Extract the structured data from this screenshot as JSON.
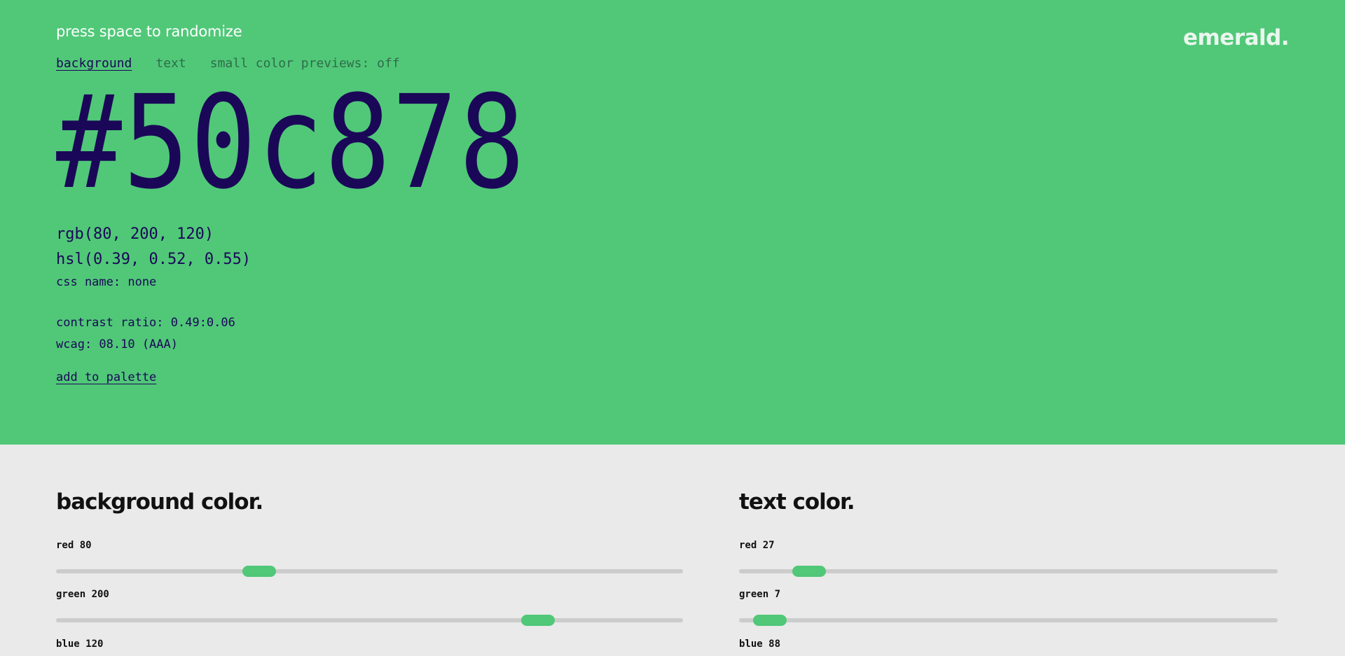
{
  "header": {
    "hint": "press space to randomize",
    "brand": "emerald."
  },
  "tabs": [
    {
      "label": "background",
      "active": true
    },
    {
      "label": "text",
      "active": false
    },
    {
      "label": "small color previews: off",
      "active": false
    }
  ],
  "color": {
    "hex": "#50c878",
    "rgb": "rgb(80, 200, 120)",
    "hsl": "hsl(0.39, 0.52, 0.55)",
    "css_name": "css name: none",
    "contrast": "contrast ratio: 0.49:0.06",
    "wcag": "wcag: 08.10 (AAA)",
    "add_label": "add to palette"
  },
  "colors": {
    "background": "#50c878",
    "text": "#1b0758",
    "panel_bg": "#eaeaea",
    "slider_thumb": "#50c878",
    "slider_track": "#cccccc"
  },
  "background_panel": {
    "title": "background color.",
    "sliders": [
      {
        "label": "red 80",
        "value": 80,
        "max": 255
      },
      {
        "label": "green 200",
        "value": 200,
        "max": 255
      },
      {
        "label": "blue 120",
        "value": 120,
        "max": 255
      }
    ]
  },
  "text_panel": {
    "title": "text color.",
    "sliders": [
      {
        "label": "red 27",
        "value": 27,
        "max": 255
      },
      {
        "label": "green 7",
        "value": 7,
        "max": 255
      },
      {
        "label": "blue 88",
        "value": 88,
        "max": 255
      }
    ]
  }
}
